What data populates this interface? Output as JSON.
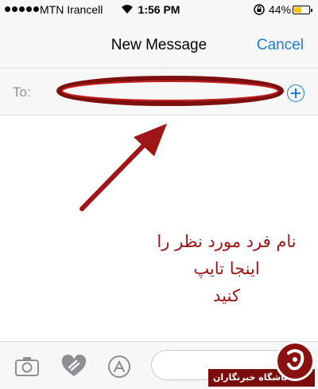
{
  "status_bar": {
    "carrier": "MTN Irancell",
    "time": "1:56 PM",
    "battery": "44%",
    "battery_level": 0.44
  },
  "nav": {
    "title": "New Message",
    "cancel_label": "Cancel"
  },
  "to_field": {
    "label": "To:",
    "value": ""
  },
  "annotation": {
    "line1": "نام فرد مورد نظر را اینجا تایپ",
    "line2": "کنید",
    "color": "#a01616"
  },
  "toolbar": {
    "icons": [
      "camera-icon",
      "digital-touch-icon",
      "app-store-icon"
    ],
    "message_value": ""
  },
  "watermark": {
    "text": "باشگاه خبرنگاران"
  },
  "colors": {
    "accent": "#1a7fd4",
    "annotation": "#a01616"
  }
}
